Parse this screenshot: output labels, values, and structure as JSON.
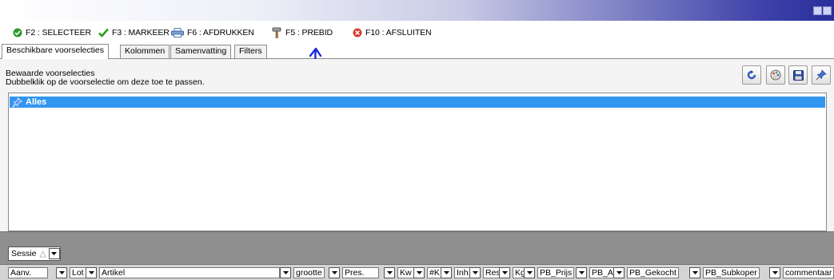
{
  "toolbar": {
    "selecteer": "F2 : SELECTEER",
    "markeer": "F3 : MARKEER",
    "afdrukken": "F6 : AFDRUKKEN",
    "prebid": "F5 : PREBID",
    "afsluiten": "F10 : AFSLUITEN"
  },
  "tabs": [
    {
      "label": "Beschikbare voorselecties"
    },
    {
      "label": "Kolommen"
    },
    {
      "label": "Samenvatting"
    },
    {
      "label": "Filters"
    }
  ],
  "panel": {
    "title": "Bewaarde voorselecties",
    "hint": "Dubbelklik op de voorselectie om deze toe te passen."
  },
  "list": {
    "items": [
      {
        "label": "Alles"
      }
    ]
  },
  "groupbar": {
    "field": "Sessie",
    "sort_symbol": "△"
  },
  "columns": [
    {
      "label": "Aanv."
    },
    {
      "label": "Lot"
    },
    {
      "label": "Artikel"
    },
    {
      "label": "grootte"
    },
    {
      "label": "Pres."
    },
    {
      "label": "Kw"
    },
    {
      "label": "#K"
    },
    {
      "label": "Inh."
    },
    {
      "label": "Rest"
    },
    {
      "label": "Kg"
    },
    {
      "label": "PB_Prijs"
    },
    {
      "label": "PB_A"
    },
    {
      "label": "PB_Gekocht"
    },
    {
      "label": "PB_Subkoper"
    },
    {
      "label": "commentaar"
    }
  ],
  "colors": {
    "selection": "#3296f0",
    "annotation_arrow": "#1a2ad8",
    "groupbar": "#8f8f8f"
  }
}
